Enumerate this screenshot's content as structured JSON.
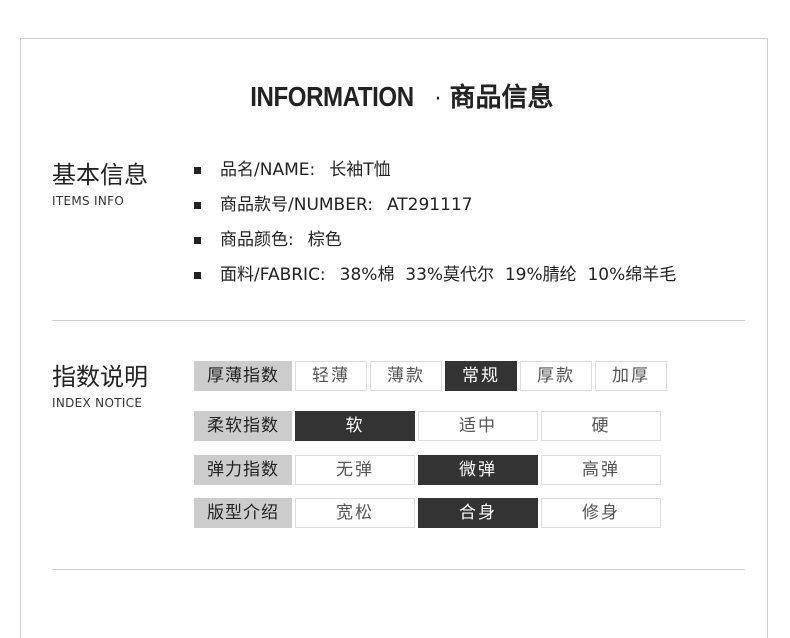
{
  "header": {
    "title_en": "INFORMATION",
    "separator": "·",
    "title_cn": "商品信息"
  },
  "basic_info": {
    "title_cn": "基本信息",
    "title_en": "ITEMS INFO",
    "items": [
      {
        "label": "品名/NAME:",
        "value": "长袖T恤"
      },
      {
        "label": "商品款号/NUMBER:",
        "value": "AT291117"
      },
      {
        "label": "商品颜色:",
        "value": "棕色"
      },
      {
        "label": "面料/FABRIC:",
        "value": "38%棉  33%莫代尔  19%腈纶  10%绵羊毛"
      }
    ]
  },
  "index_notice": {
    "title_cn": "指数说明",
    "title_en": "INDEX NOTICE",
    "rows": [
      {
        "label": "厚薄指数",
        "options": [
          "轻薄",
          "薄款",
          "常规",
          "厚款",
          "加厚"
        ],
        "selected": "常规"
      },
      {
        "label": "柔软指数",
        "options": [
          "软",
          "适中",
          "硬"
        ],
        "selected": "软"
      },
      {
        "label": "弹力指数",
        "options": [
          "无弹",
          "微弹",
          "高弹"
        ],
        "selected": "微弹"
      },
      {
        "label": "版型介绍",
        "options": [
          "宽松",
          "合身",
          "修身"
        ],
        "selected": "合身"
      }
    ]
  },
  "colors": {
    "selected_bg": "#333333",
    "label_bg": "#cccccc",
    "border": "#dcdcdc"
  }
}
